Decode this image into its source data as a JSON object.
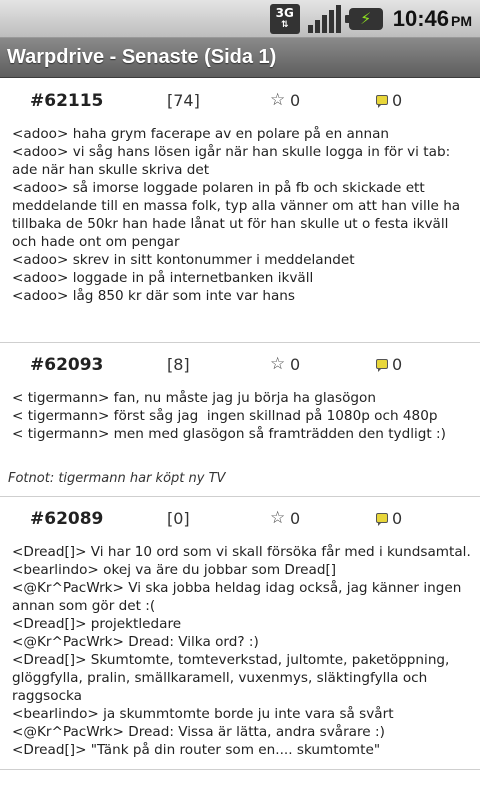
{
  "status_bar": {
    "network": "3G",
    "time": "10:46",
    "ampm": "PM"
  },
  "app": {
    "title": "Warpdrive - Senaste (Sida 1)"
  },
  "quotes": [
    {
      "id": "#62115",
      "score": "[74]",
      "stars": "0",
      "comments": "0",
      "lines": [
        "<adoo> haha grym facerape av en polare på en annan",
        "<adoo> vi såg hans lösen igår när han skulle logga in för vi tab: ade när han skulle skriva det",
        "<adoo> så imorse loggade polaren in på fb och skickade ett meddelande till en massa folk, typ alla vänner om att han ville ha tillbaka de 50kr han hade lånat ut för han skulle ut o festa ikväll och hade ont om pengar",
        "<adoo> skrev in sitt kontonummer i meddelandet",
        "<adoo> loggade in på internetbanken ikväll",
        "<adoo> låg 850 kr där som inte var hans"
      ],
      "footnote": ""
    },
    {
      "id": "#62093",
      "score": "[8]",
      "stars": "0",
      "comments": "0",
      "lines": [
        "< tigermann> fan, nu måste jag ju börja ha glasögon",
        "< tigermann> först såg jag  ingen skillnad på 1080p och 480p",
        "< tigermann> men med glasögon så framträdden den tydligt :)"
      ],
      "footnote": "Fotnot: tigermann har köpt ny TV"
    },
    {
      "id": "#62089",
      "score": "[0]",
      "stars": "0",
      "comments": "0",
      "lines": [
        "<Dread[]> Vi har 10 ord som vi skall försöka får med i kundsamtal.",
        "<bearlindo> okej va äre du jobbar som Dread[]",
        "<@Kr^PacWrk> Vi ska jobba heldag idag också, jag känner ingen annan som gör det :(",
        "<Dread[]> projektledare",
        "<@Kr^PacWrk> Dread: Vilka ord? :)",
        "<Dread[]> Skumtomte, tomteverkstad, jultomte, paketöppning, glöggfylla, pralin, smällkaramell, vuxenmys, släktingfylla och raggsocka",
        "<bearlindo> ja skummtomte borde ju inte vara så svårt",
        "<@Kr^PacWrk> Dread: Vissa är lätta, andra svårare :)",
        "<Dread[]> \"Tänk på din router som en.... skumtomte\""
      ],
      "footnote": ""
    }
  ]
}
